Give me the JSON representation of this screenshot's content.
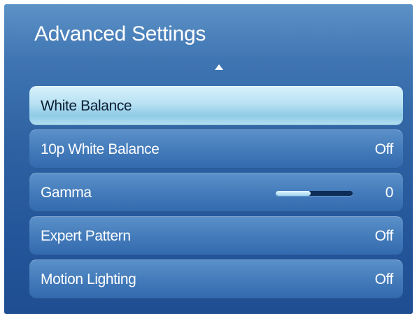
{
  "panel": {
    "title": "Advanced Settings",
    "scroll_up_icon": "up-triangle-icon"
  },
  "menu": {
    "items": [
      {
        "id": "white-balance",
        "label": "White Balance",
        "value": "",
        "selected": true
      },
      {
        "id": "10p-white-balance",
        "label": "10p White Balance",
        "value": "Off",
        "selected": false
      },
      {
        "id": "gamma",
        "label": "Gamma",
        "value": "0",
        "selected": false,
        "slider_fraction": 0.45
      },
      {
        "id": "expert-pattern",
        "label": "Expert Pattern",
        "value": "Off",
        "selected": false
      },
      {
        "id": "motion-lighting",
        "label": "Motion Lighting",
        "value": "Off",
        "selected": false
      }
    ]
  },
  "colors": {
    "panel_blue": "#2e62a2",
    "item_blue": "#447cbb",
    "selected_highlight": "#b7e1f3",
    "text": "#ffffff",
    "selected_text": "#0c1f33"
  }
}
